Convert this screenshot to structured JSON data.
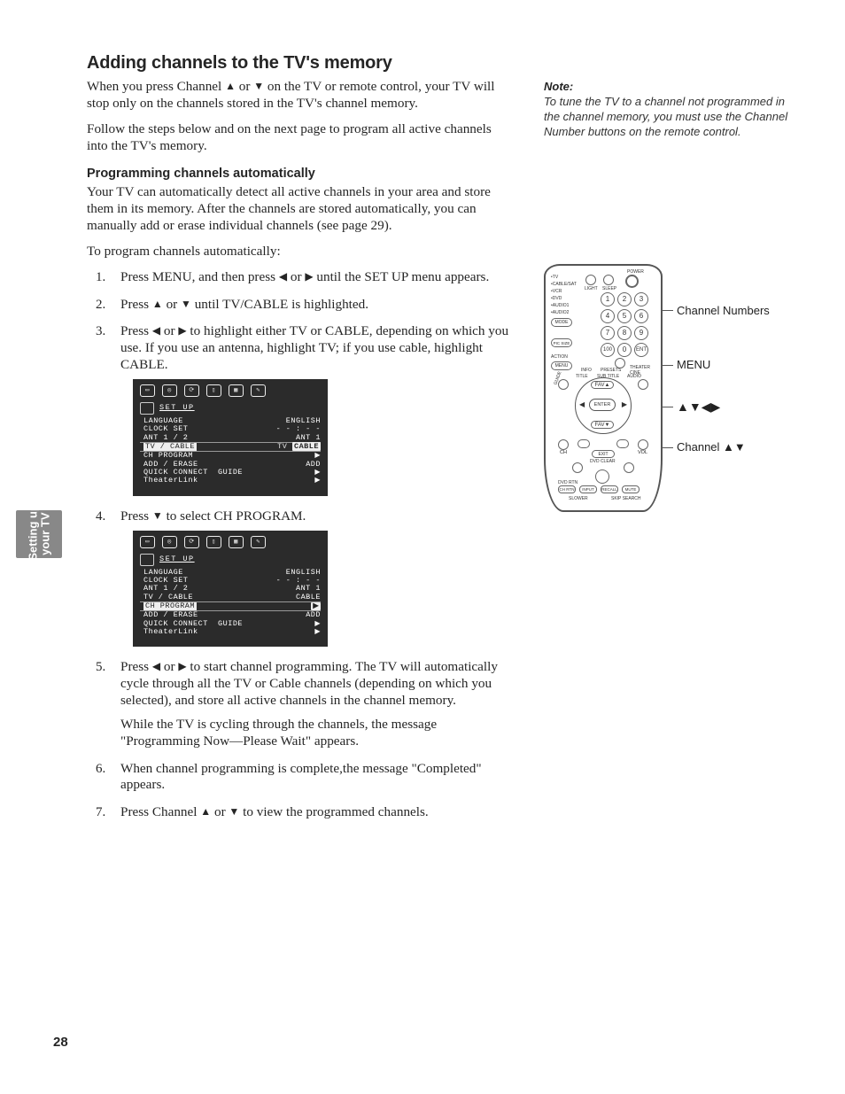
{
  "page_number": "28",
  "side_tab": {
    "line1": "Setting up",
    "line2": "your TV"
  },
  "title": "Adding channels to the TV's memory",
  "intro1_a": "When you press Channel ",
  "intro1_b": " or ",
  "intro1_c": " on the TV or remote control, your TV will stop only on the channels stored in the TV's channel memory.",
  "intro2": "Follow the steps below and on the next page to program all active channels into the TV's memory.",
  "subheading": "Programming channels automatically",
  "para_auto": "Your TV can automatically detect all active channels in your area and store them in its memory. After the channels are stored automatically, you can manually add or erase individual channels (see page 29).",
  "para_lead": "To program channels automatically:",
  "steps": {
    "s1_a": "Press MENU, and then press ",
    "s1_b": " or ",
    "s1_c": " until the SET UP menu appears.",
    "s2_a": "Press ",
    "s2_b": " or ",
    "s2_c": " until TV/CABLE is highlighted.",
    "s3_a": "Press ",
    "s3_b": " or ",
    "s3_c": " to highlight either TV or CABLE, depending on which you use. If you use an antenna, highlight TV; if you use cable, highlight CABLE.",
    "s4_a": "Press ",
    "s4_b": " to select CH PROGRAM.",
    "s5_a": "Press ",
    "s5_b": " or ",
    "s5_c": " to start channel programming. The TV will automatically cycle through all the TV or Cable channels (depending on which you selected), and store all active channels in the channel memory.",
    "s5_sub": "While the TV is cycling through the channels, the message \"Programming Now—Please Wait\" appears.",
    "s6": "When channel programming is complete,the message \"Completed\" appears.",
    "s7_a": "Press Channel ",
    "s7_b": " or ",
    "s7_c": " to view the programmed channels."
  },
  "arrows": {
    "up": "▲",
    "down": "▼",
    "left": "◀",
    "right": "▶"
  },
  "note": {
    "heading": "Note:",
    "body": "To tune the TV to a channel not programmed in the channel memory, you must use the Channel Number buttons on the remote control."
  },
  "osd": {
    "title": "SET UP",
    "rows": [
      {
        "l": "LANGUAGE",
        "r": "ENGLISH"
      },
      {
        "l": "CLOCK SET",
        "r": "- - : - -"
      },
      {
        "l": "ANT 1 / 2",
        "r": "ANT 1"
      }
    ],
    "tvcable_row": {
      "l": "TV / CABLE",
      "r_tv": "TV",
      "r_cable": "CABLE"
    },
    "chprogram": "CH PROGRAM",
    "adderase_row": {
      "l": "ADD / ERASE",
      "r": "ADD"
    },
    "quickconnect": "QUICK CONNECT  GUIDE",
    "theaterlink": "TheaterLink"
  },
  "remote": {
    "labels": {
      "channel_numbers": "Channel Numbers",
      "menu": "MENU",
      "arrows": "▲▼◀▶",
      "channel_updown": "Channel ▲▼"
    },
    "device_labels": [
      "TV",
      "CABLE/SAT",
      "VCR",
      "DVD",
      "AUDIO1",
      "AUDIO2"
    ],
    "mode_btn": "MODE",
    "power_label": "POWER",
    "top_small": [
      "LIGHT",
      "SLEEP"
    ],
    "keypad": [
      "1",
      "2",
      "3",
      "4",
      "5",
      "6",
      "7",
      "8",
      "9",
      "100",
      "0",
      "ENT"
    ],
    "picsize": "PIC SIZE",
    "action": "ACTION",
    "menu_btn": "MENU",
    "ring_labels": {
      "info": "INFO",
      "presets": "PRESETS",
      "theater": "THEATER CINE",
      "mute": "MUTE",
      "guide": "GUIDE",
      "title": "TITLE",
      "subtitle": "SUB TITLE",
      "audio": "AUDIO"
    },
    "fav_up": "FAV▲",
    "fav_down": "FAV▼",
    "enter": "ENTER",
    "ch": "CH",
    "vol": "VOL",
    "exit": "EXIT",
    "dvdclear": "DVD CLEAR",
    "tri_left": "◀◀",
    "tri_right": "▶▶",
    "play": "▶",
    "stop_rec": "●",
    "bottom_row": [
      "CH RTN",
      "INPUT",
      "RECALL",
      "MUTE"
    ],
    "bottom_labels": {
      "dvdrtn": "DVD RTN",
      "slower": "SLOWER",
      "skipsearch": "SKIP SEARCH"
    }
  }
}
